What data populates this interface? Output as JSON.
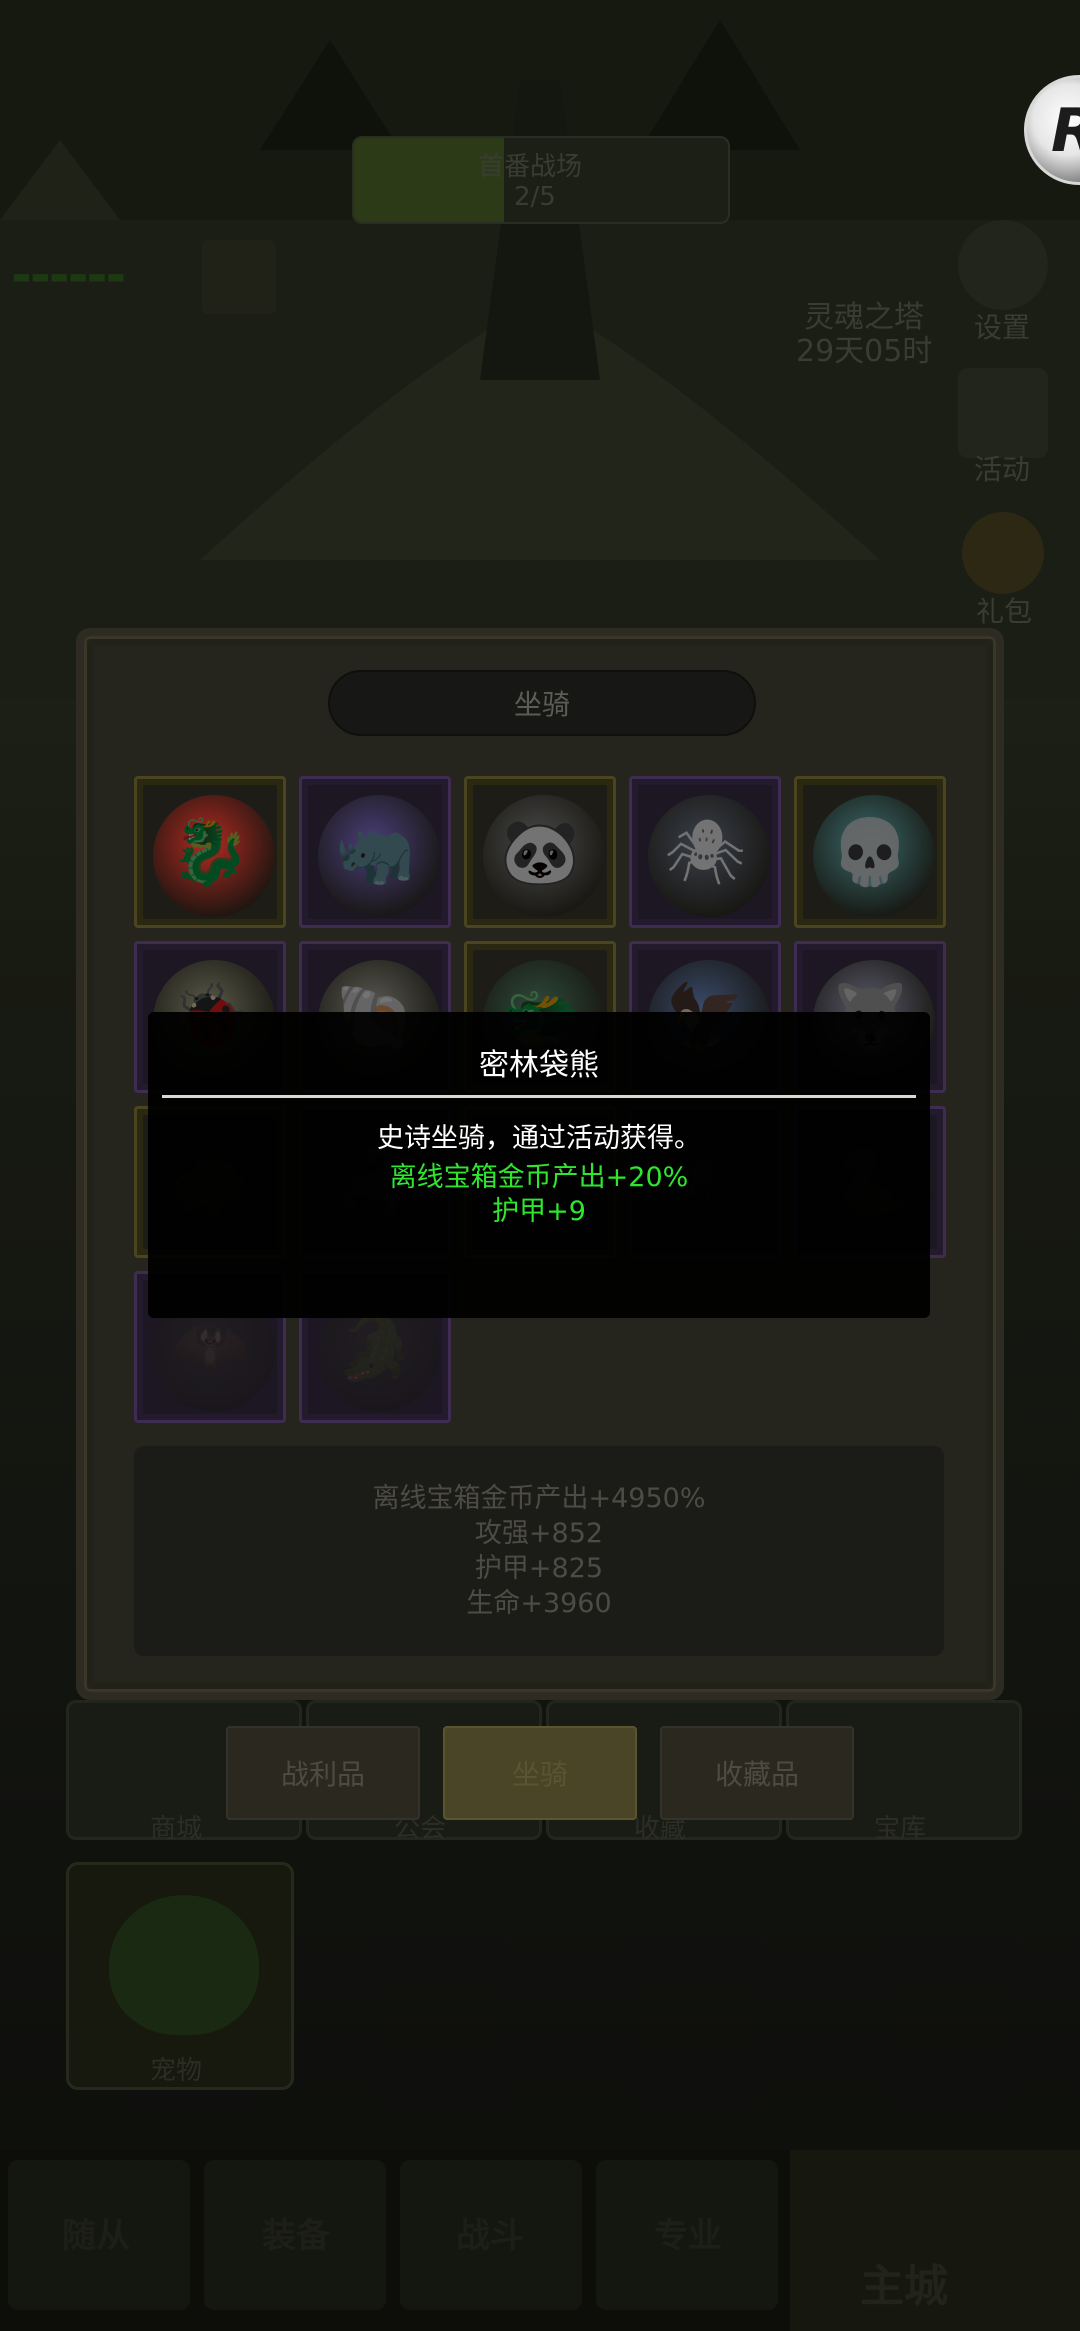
{
  "hud": {
    "event_title": "首番战场",
    "event_progress": "2/5",
    "tower_name": "灵魂之塔",
    "tower_timer": "29天05时",
    "settings_label": "设置",
    "activity_label": "活动",
    "gift_label": "礼包",
    "logo_letter": "R"
  },
  "background_buttons": {
    "shop": "商城",
    "guild": "公会",
    "collect": "收藏",
    "treasury": "宝库",
    "pet": "宠物"
  },
  "bottom_nav": {
    "followers": "随从",
    "equipment": "装备",
    "battle": "战斗",
    "profession": "专业",
    "home": "主城"
  },
  "panel": {
    "title": "坐骑",
    "summary": [
      "离线宝箱金币产出+4950%",
      "攻强+852",
      "护甲+825",
      "生命+3960"
    ],
    "tabs": [
      "战利品",
      "坐骑",
      "收藏品"
    ],
    "active_tab": "坐骑"
  },
  "mounts": [
    {
      "name": "red-armored-beast",
      "rarity": "legendary",
      "icon": "🐉",
      "color": "#b12a22"
    },
    {
      "name": "purple-stone-beast",
      "rarity": "epic",
      "icon": "🦏",
      "color": "#4a3f78"
    },
    {
      "name": "panda-mount",
      "rarity": "legendary",
      "icon": "🐼",
      "color": "#4a4a4a"
    },
    {
      "name": "mech-spider",
      "rarity": "epic",
      "icon": "🕷",
      "color": "#3a3f4a"
    },
    {
      "name": "skull-mount",
      "rarity": "legendary",
      "icon": "💀",
      "color": "#3a6a6a"
    },
    {
      "name": "white-beetle",
      "rarity": "epic",
      "icon": "🐞",
      "color": "#5a5a4a"
    },
    {
      "name": "swirl-shell",
      "rarity": "epic",
      "icon": "🐚",
      "color": "#5a5a52"
    },
    {
      "name": "green-dragon",
      "rarity": "legendary",
      "icon": "🐲",
      "color": "#2f4a3a"
    },
    {
      "name": "blue-phoenix",
      "rarity": "epic",
      "icon": "🦅",
      "color": "#3a4a6a"
    },
    {
      "name": "frost-wolf",
      "rarity": "epic",
      "icon": "🐺",
      "color": "#5a5a6a"
    },
    {
      "name": "locked-1",
      "rarity": "legendary",
      "icon": "🐢",
      "color": "#2a2a22"
    },
    {
      "name": "locked-2",
      "rarity": "epic",
      "icon": "🦂",
      "color": "#2a2a22"
    },
    {
      "name": "locked-3",
      "rarity": "legendary",
      "icon": "🦎",
      "color": "#2a2a22"
    },
    {
      "name": "locked-4",
      "rarity": "epic",
      "icon": "🐗",
      "color": "#2a2a22"
    },
    {
      "name": "locked-5",
      "rarity": "epic",
      "icon": "🐍",
      "color": "#2a2a22"
    },
    {
      "name": "locked-6",
      "rarity": "epic",
      "icon": "🦇",
      "color": "#2a2a22"
    },
    {
      "name": "locked-7",
      "rarity": "epic",
      "icon": "🐊",
      "color": "#2a2a22"
    }
  ],
  "tooltip": {
    "name": "密林袋熊",
    "description": "史诗坐骑，通过活动获得。",
    "attributes": [
      "离线宝箱金币产出+20%",
      "护甲+9"
    ]
  }
}
